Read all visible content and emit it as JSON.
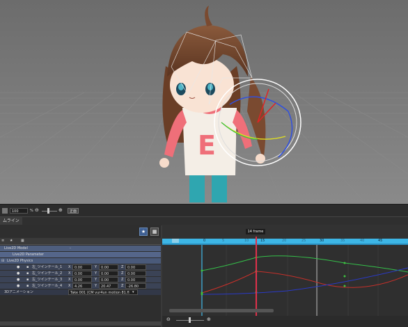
{
  "toolbar": {
    "zoom_value": "100",
    "zoom_unit": "%",
    "front_label": "正面"
  },
  "tab": {
    "label": "ムライン"
  },
  "tree": {
    "items": [
      {
        "label": "Live2D Model",
        "value": "-"
      },
      {
        "label": "Live2D Parameter"
      },
      {
        "label": "Live2D Physics"
      }
    ],
    "bones": [
      {
        "name": "左_ツインテール_1",
        "x": "0.00",
        "y": "0.00",
        "z": "0.00"
      },
      {
        "name": "左_ツインテール_2",
        "x": "0.00",
        "y": "0.00",
        "z": "0.00"
      },
      {
        "name": "左_ツインテール_3",
        "x": "0.00",
        "y": "0.00",
        "z": "0.00"
      },
      {
        "name": "左_ツインテール_4",
        "x": "4.26",
        "y": "20.47",
        "z": "-26.80"
      }
    ],
    "axis": {
      "x": "X",
      "y": "Y",
      "z": "Z"
    },
    "animation_label": "3Dアニメーション",
    "animation_value": "Take 001 (CM vur4un motion 81.fl"
  },
  "timeline": {
    "current_frame_label": "14 frame",
    "ticks": [
      "0",
      "15",
      "30",
      "45"
    ],
    "minor_ticks": [
      "5",
      "10",
      "20",
      "25",
      "35",
      "40"
    ]
  },
  "colors": {
    "accent": "#3e5f93",
    "playhead": "#e0304a",
    "curve_green": "#35c24a",
    "curve_red": "#c8302a",
    "curve_blue": "#2a3ac8"
  }
}
